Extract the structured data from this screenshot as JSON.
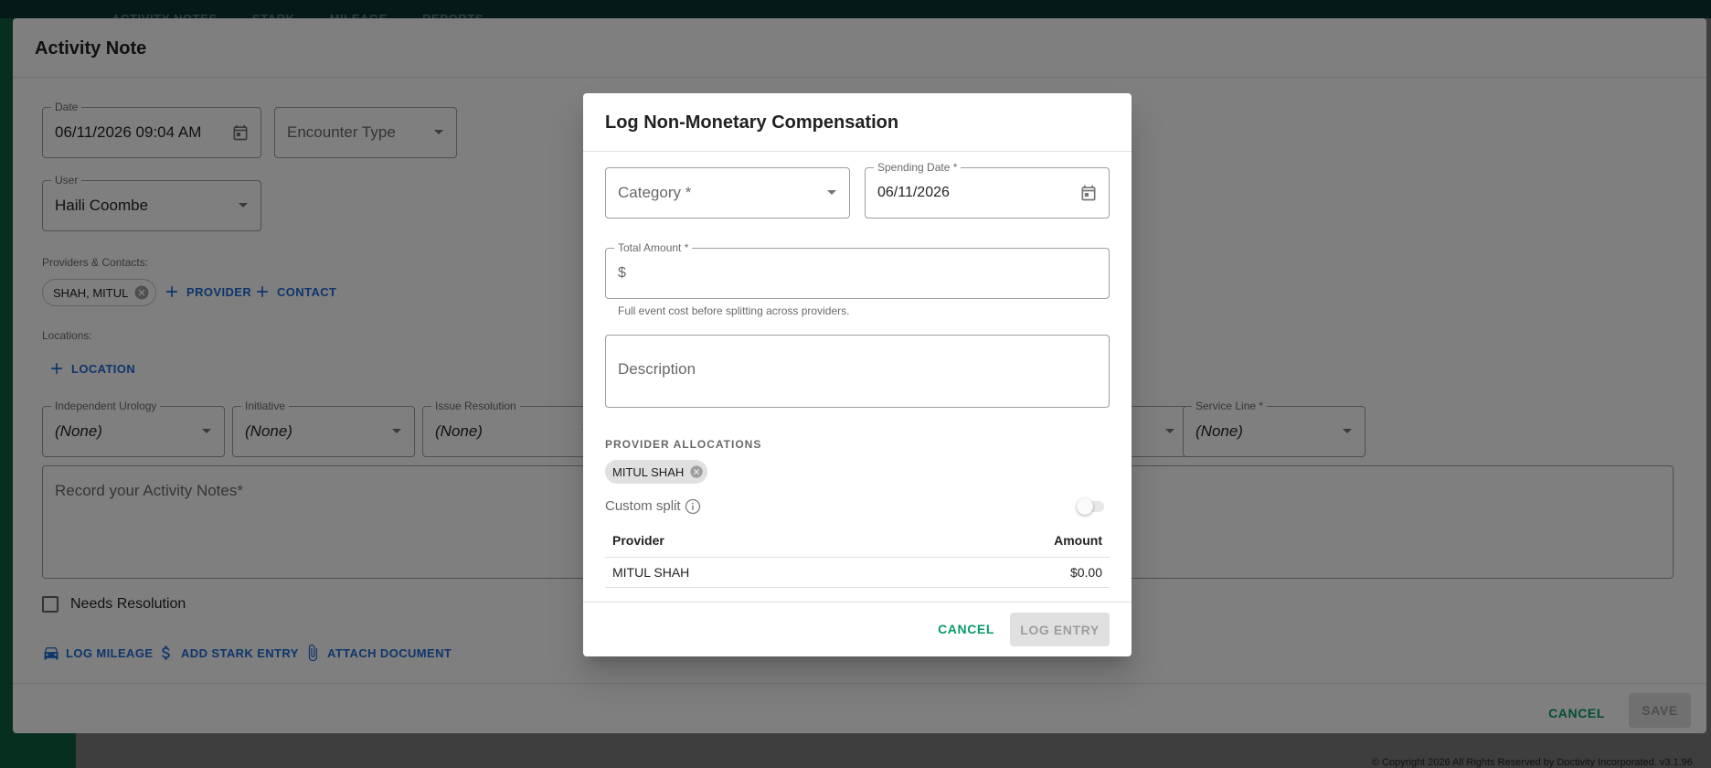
{
  "background_app": {
    "nav_tabs": [
      "ACTIVITY NOTES",
      "STARK",
      "MILEAGE",
      "REPORTS"
    ],
    "footer": "© Copyright 2026 All Rights Reserved by Doctivity Incorporated. v3.1.96"
  },
  "activity_note": {
    "title": "Activity Note",
    "date": {
      "label": "Date",
      "value": "06/11/2026 09:04 AM"
    },
    "encounter_type": {
      "placeholder": "Encounter Type"
    },
    "user": {
      "label": "User",
      "value": "Haili Coombe"
    },
    "providers_contacts": {
      "label": "Providers & Contacts:",
      "chips": [
        "SHAH, MITUL"
      ],
      "add_provider": "PROVIDER",
      "add_contact": "CONTACT"
    },
    "locations": {
      "label": "Locations:",
      "add_location": "LOCATION"
    },
    "dropdowns": [
      {
        "label": "Independent Urology",
        "value": "(None)"
      },
      {
        "label": "Initiative",
        "value": "(None)"
      },
      {
        "label": "Issue Resolution",
        "value": "(None)"
      },
      {
        "label": "",
        "value": ""
      },
      {
        "label": "Service Line *",
        "value": "(None)"
      }
    ],
    "notes_placeholder": "Record your Activity Notes*",
    "needs_resolution": "Needs Resolution",
    "actions": {
      "log_mileage": "LOG MILEAGE",
      "add_stark": "ADD STARK ENTRY",
      "attach_document": "ATTACH DOCUMENT"
    },
    "footer": {
      "cancel": "CANCEL",
      "save": "SAVE"
    }
  },
  "dialog": {
    "title": "Log Non-Monetary Compensation",
    "category": {
      "placeholder": "Category *"
    },
    "spending_date": {
      "label": "Spending Date *",
      "value": "06/11/2026"
    },
    "total_amount": {
      "label": "Total Amount *",
      "prefix": "$",
      "value": "",
      "helper": "Full event cost before splitting across providers."
    },
    "description": {
      "placeholder": "Description"
    },
    "allocations": {
      "heading": "PROVIDER ALLOCATIONS",
      "chips": [
        "MITUL SHAH"
      ],
      "custom_split_label": "Custom split",
      "custom_split_on": false,
      "columns": [
        "Provider",
        "Amount"
      ],
      "rows": [
        {
          "provider": "MITUL SHAH",
          "amount": "$0.00"
        }
      ]
    },
    "footer": {
      "cancel": "CANCEL",
      "log_entry": "LOG ENTRY"
    }
  },
  "colors": {
    "primary_green": "#0a9b69",
    "link_blue": "#1e6bd6",
    "sidebar": "#0c5f3f"
  }
}
